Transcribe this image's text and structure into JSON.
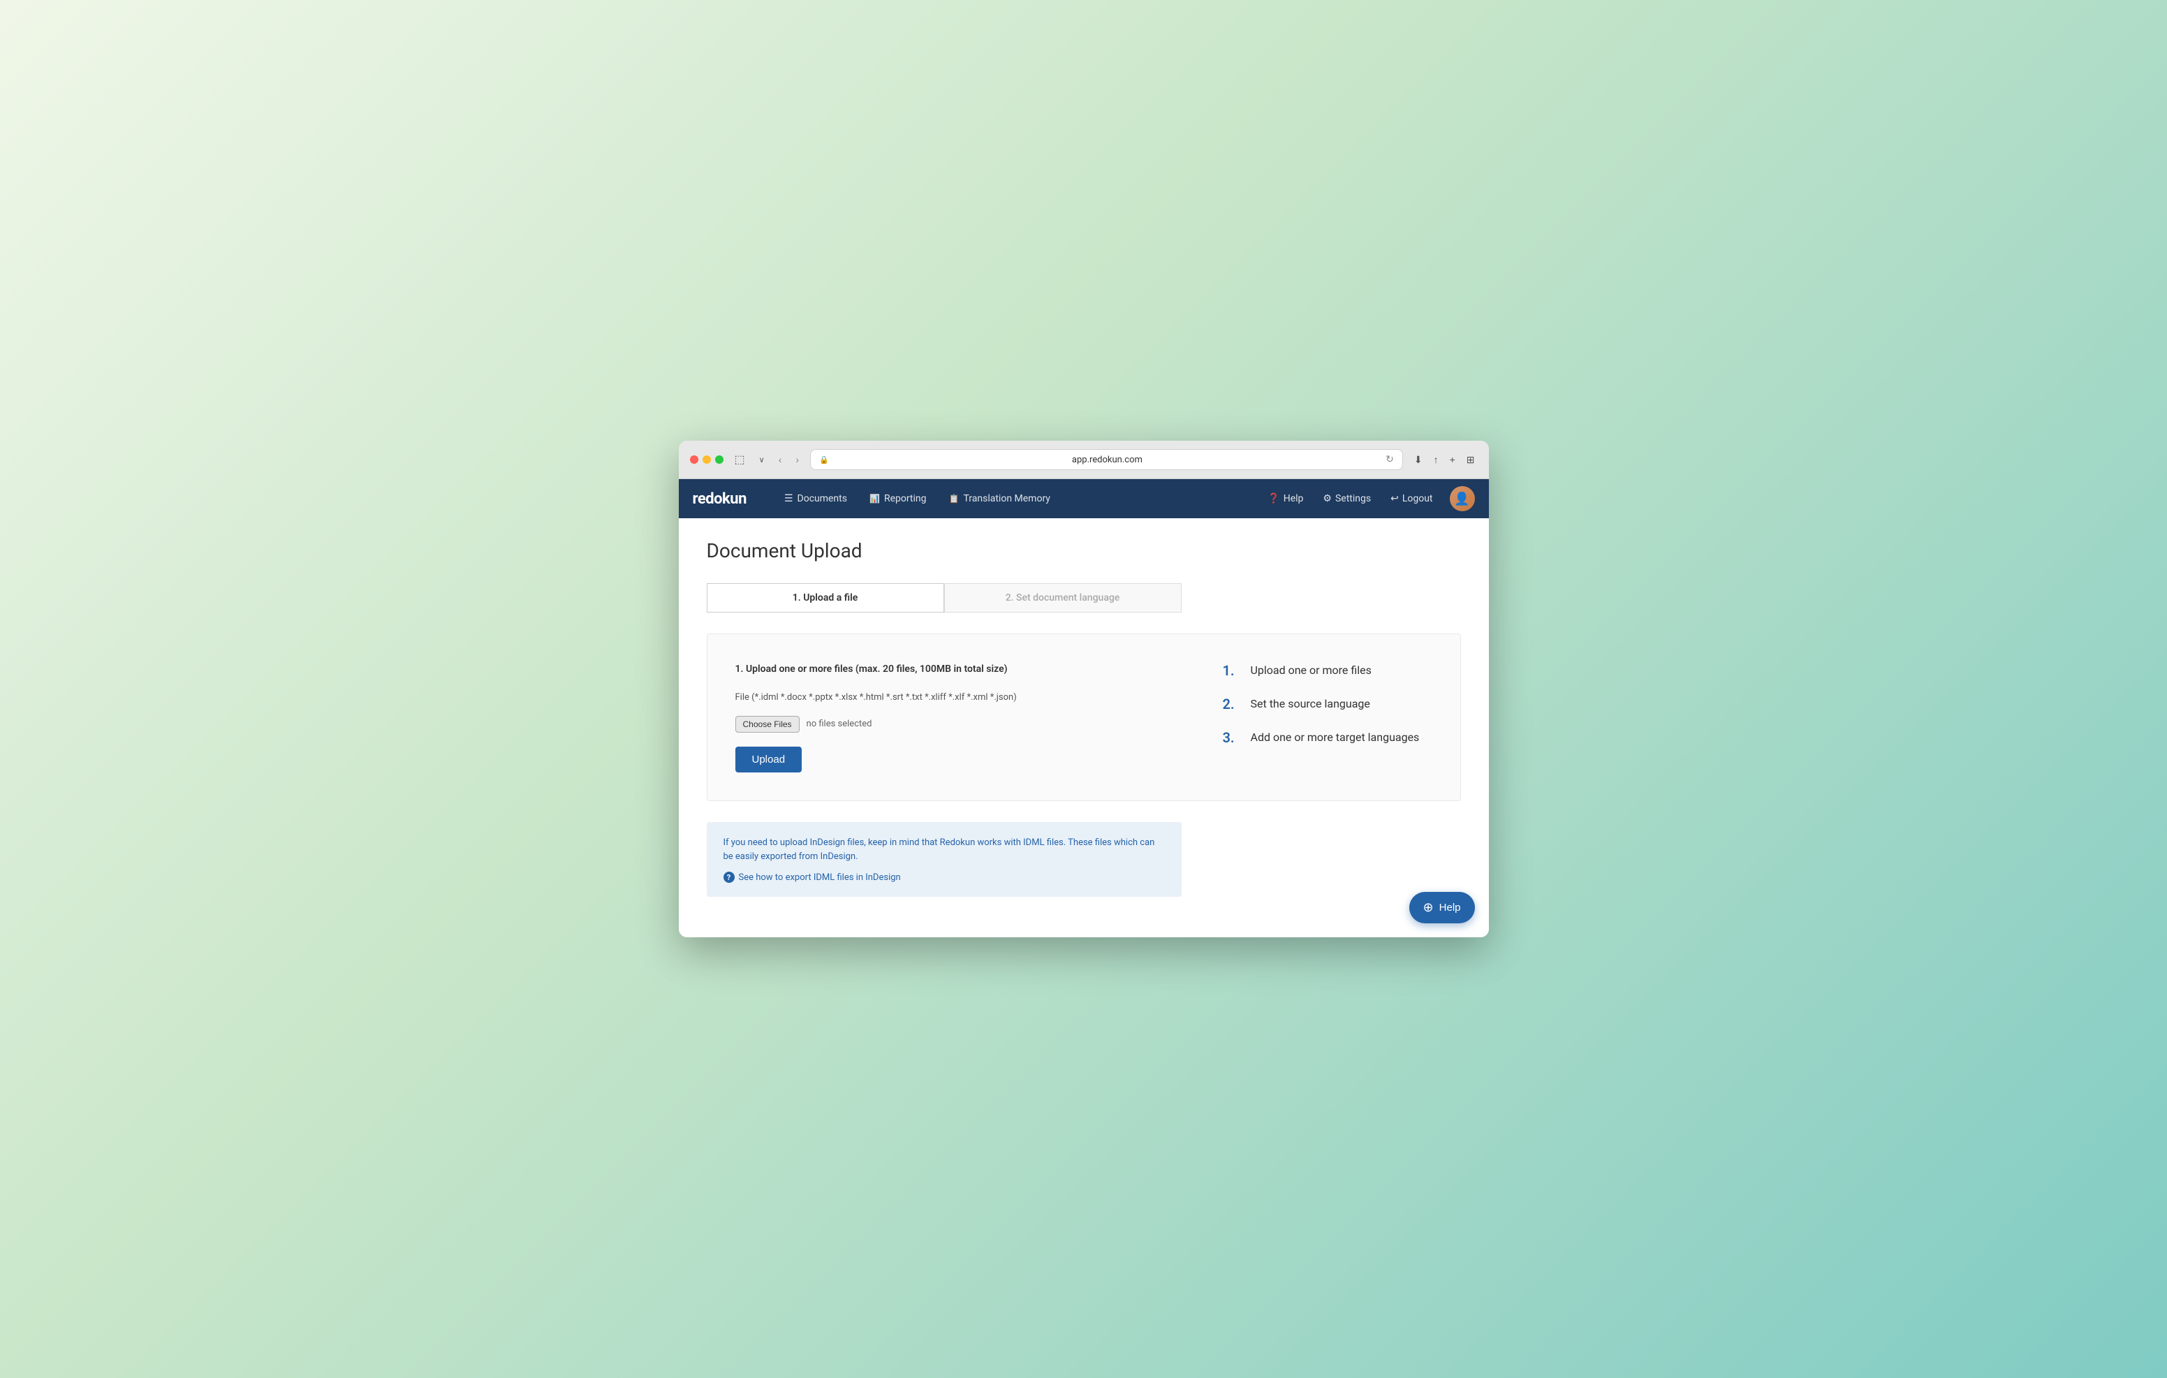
{
  "browser": {
    "url": "app.redokun.com",
    "back_btn": "‹",
    "forward_btn": "›"
  },
  "navbar": {
    "brand": "redokun",
    "links": [
      {
        "id": "documents",
        "icon": "☰",
        "label": "Documents"
      },
      {
        "id": "reporting",
        "icon": "📊",
        "label": "Reporting"
      },
      {
        "id": "translation-memory",
        "icon": "📋",
        "label": "Translation Memory"
      }
    ],
    "right_links": [
      {
        "id": "help",
        "icon": "❓",
        "label": "Help"
      },
      {
        "id": "settings",
        "icon": "⚙",
        "label": "Settings"
      },
      {
        "id": "logout",
        "icon": "↩",
        "label": "Logout"
      }
    ]
  },
  "page": {
    "title": "Document Upload"
  },
  "steps_bar": [
    {
      "id": "step1",
      "label": "1. Upload a file",
      "active": true
    },
    {
      "id": "step2",
      "label": "2. Set document language",
      "active": false
    }
  ],
  "upload_section": {
    "description": "1. Upload one or more files (max. 20 files, 100MB in total size)",
    "file_types": "File (*.idml *.docx *.pptx *.xlsx *.html *.srt *.txt *.xliff *.xlf *.xml *.json)",
    "choose_files_label": "Choose Files",
    "no_files_text": "no files selected",
    "upload_button": "Upload"
  },
  "instructions": [
    {
      "number": "1.",
      "text": "Upload one or more files"
    },
    {
      "number": "2.",
      "text": "Set the source language"
    },
    {
      "number": "3.",
      "text": "Add one or more target languages"
    }
  ],
  "info_box": {
    "text": "If you need to upload InDesign files, keep in mind that Redokun works with IDML files. These files which can be easily exported from InDesign.",
    "link_icon": "?",
    "link_text": "See how to export IDML files in InDesign"
  },
  "help_fab": {
    "label": "Help"
  }
}
